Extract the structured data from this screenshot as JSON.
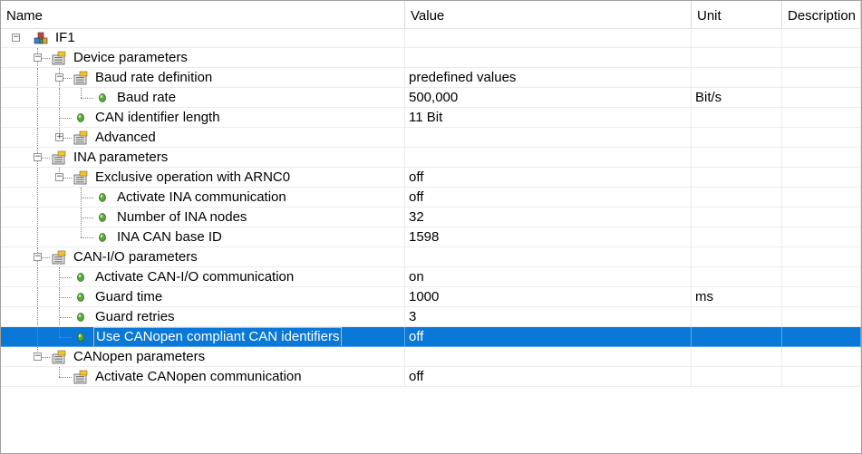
{
  "header": {
    "name": "Name",
    "value": "Value",
    "unit": "Unit",
    "description": "Description"
  },
  "rows": [
    {
      "label": "IF1",
      "value": "",
      "unit": "",
      "desc": "",
      "level": 0,
      "type": "root",
      "expander": "minus"
    },
    {
      "label": "Device parameters",
      "value": "",
      "unit": "",
      "desc": "",
      "level": 1,
      "type": "folder",
      "expander": "minus"
    },
    {
      "label": "Baud rate definition",
      "value": "predefined values",
      "unit": "",
      "desc": "",
      "level": 2,
      "type": "folder",
      "expander": "minus"
    },
    {
      "label": "Baud rate",
      "value": "500,000",
      "unit": "Bit/s",
      "desc": "",
      "level": 3,
      "type": "leaf",
      "expander": ""
    },
    {
      "label": "CAN identifier length",
      "value": "11 Bit",
      "unit": "",
      "desc": "",
      "level": 2,
      "type": "leaf",
      "expander": ""
    },
    {
      "label": "Advanced",
      "value": "",
      "unit": "",
      "desc": "",
      "level": 2,
      "type": "folder",
      "expander": "plus"
    },
    {
      "label": "INA parameters",
      "value": "",
      "unit": "",
      "desc": "",
      "level": 1,
      "type": "folder",
      "expander": "minus"
    },
    {
      "label": "Exclusive operation with ARNC0",
      "value": "off",
      "unit": "",
      "desc": "",
      "level": 2,
      "type": "folder",
      "expander": "minus"
    },
    {
      "label": "Activate INA communication",
      "value": "off",
      "unit": "",
      "desc": "",
      "level": 3,
      "type": "leaf",
      "expander": ""
    },
    {
      "label": "Number of INA nodes",
      "value": "32",
      "unit": "",
      "desc": "",
      "level": 3,
      "type": "leaf",
      "expander": ""
    },
    {
      "label": "INA CAN base ID",
      "value": "1598",
      "unit": "",
      "desc": "",
      "level": 3,
      "type": "leaf",
      "expander": ""
    },
    {
      "label": "CAN-I/O parameters",
      "value": "",
      "unit": "",
      "desc": "",
      "level": 1,
      "type": "folder",
      "expander": "minus"
    },
    {
      "label": "Activate CAN-I/O communication",
      "value": "on",
      "unit": "",
      "desc": "",
      "level": 2,
      "type": "leaf",
      "expander": ""
    },
    {
      "label": "Guard time",
      "value": "1000",
      "unit": "ms",
      "desc": "",
      "level": 2,
      "type": "leaf",
      "expander": ""
    },
    {
      "label": "Guard retries",
      "value": "3",
      "unit": "",
      "desc": "",
      "level": 2,
      "type": "leaf",
      "expander": ""
    },
    {
      "label": "Use CANopen compliant CAN identifiers",
      "value": "off",
      "unit": "",
      "desc": "",
      "level": 2,
      "type": "leaf",
      "expander": "",
      "selected": true
    },
    {
      "label": "CANopen parameters",
      "value": "",
      "unit": "",
      "desc": "",
      "level": 1,
      "type": "folder",
      "expander": "minus"
    },
    {
      "label": "Activate CANopen communication",
      "value": "off",
      "unit": "",
      "desc": "",
      "level": 2,
      "type": "folder",
      "expander": ""
    }
  ],
  "colors": {
    "selection": "#0a78d7",
    "leaf_green": "#5aa83c"
  }
}
